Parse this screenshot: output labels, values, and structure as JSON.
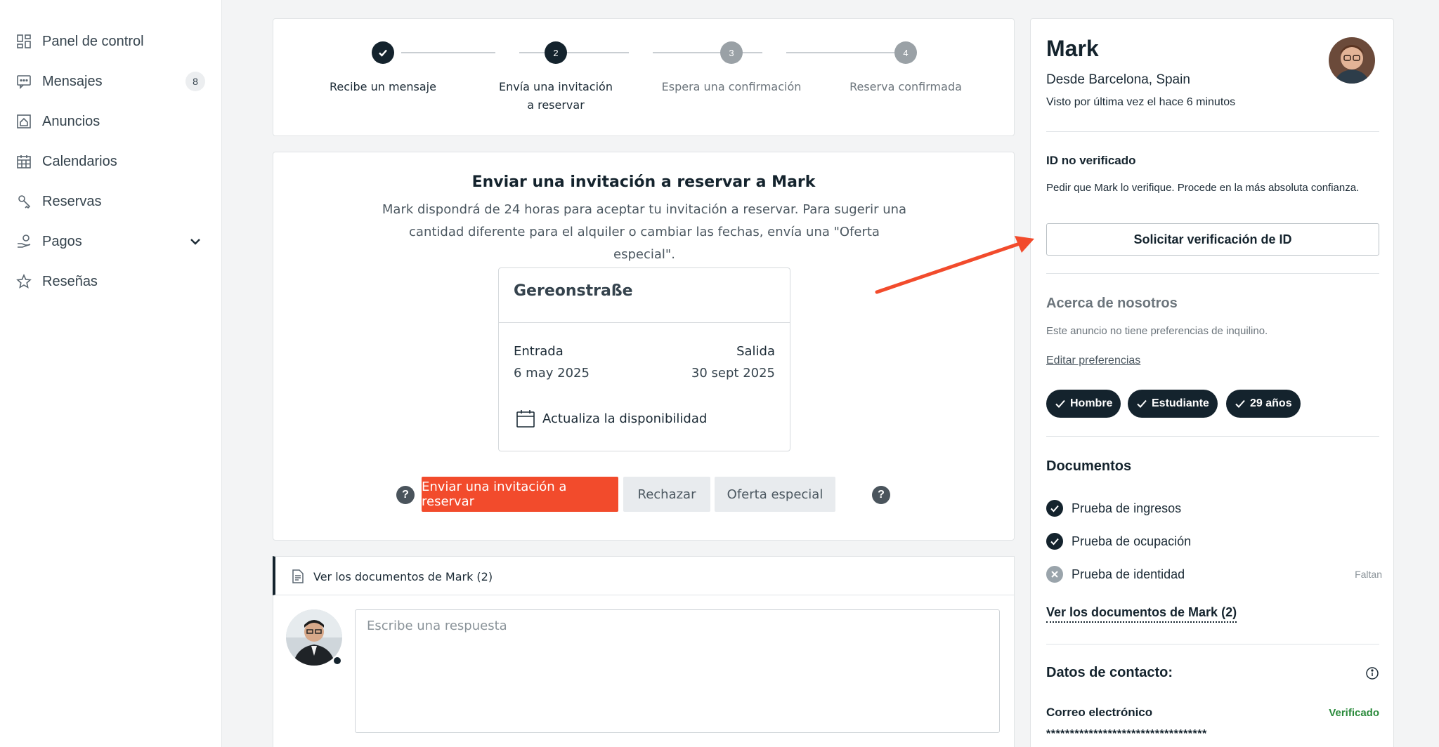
{
  "sidebar": {
    "items": [
      {
        "label": "Panel de control",
        "icon": "dashboard-icon"
      },
      {
        "label": "Mensajes",
        "icon": "message-icon",
        "badge": "8"
      },
      {
        "label": "Anuncios",
        "icon": "listing-icon"
      },
      {
        "label": "Calendarios",
        "icon": "calendar-icon"
      },
      {
        "label": "Reservas",
        "icon": "booking-icon"
      },
      {
        "label": "Pagos",
        "icon": "payment-icon"
      },
      {
        "label": "Reseñas",
        "icon": "star-icon"
      }
    ]
  },
  "stepper": {
    "steps": [
      {
        "number": "1",
        "label": "Recibe un mensaje",
        "state": "done"
      },
      {
        "number": "2",
        "label": "Envía una invitación a reservar",
        "state": "active"
      },
      {
        "number": "3",
        "label": "Espera una confirmación",
        "state": "pending"
      },
      {
        "number": "4",
        "label": "Reserva confirmada",
        "state": "pending"
      }
    ]
  },
  "invitation": {
    "title": "Enviar una invitación a reservar a Mark",
    "description": "Mark dispondrá de 24 horas para aceptar tu invitación a reservar. Para sugerir una cantidad diferente para el alquiler o cambiar las fechas, envía una \"Oferta especial\".",
    "listing": {
      "name": "Gereonstraße",
      "checkin_label": "Entrada",
      "checkin_value": "6 may 2025",
      "checkout_label": "Salida",
      "checkout_value": "30 sept 2025",
      "availability_label": "Actualiza la disponibilidad"
    },
    "actions": {
      "help_symbol": "?",
      "send_label": "Enviar una invitación a reservar",
      "reject_label": "Rechazar",
      "special_offer_label": "Oferta especial"
    }
  },
  "documents_bar": {
    "label": "Ver los documentos de Mark (2)"
  },
  "reply": {
    "placeholder": "Escribe una respuesta"
  },
  "profile": {
    "name": "Mark",
    "from": "Desde Barcelona, Spain",
    "last_seen": "Visto por última vez el hace 6 minutos",
    "id_status_title": "ID no verificado",
    "id_status_text": "Pedir que Mark lo verifique. Procede en la más absoluta confianza.",
    "verify_button": "Solicitar verificación de ID",
    "about_title": "Acerca de nosotros",
    "about_text": "Este anuncio no tiene preferencias de inquilino.",
    "edit_preferences": "Editar preferencias",
    "chips": [
      "Hombre",
      "Estudiante",
      "29 años"
    ],
    "documents_title": "Documentos",
    "documents": [
      {
        "label": "Prueba de ingresos",
        "status": "ok",
        "note": ""
      },
      {
        "label": "Prueba de ocupación",
        "status": "ok",
        "note": ""
      },
      {
        "label": "Prueba de identidad",
        "status": "missing",
        "note": "Faltan"
      }
    ],
    "documents_link": "Ver los documentos de Mark (2)",
    "contact_title": "Datos de contacto:",
    "email_label": "Correo electrónico",
    "email_status": "Verificado",
    "email_value": "**********************************"
  },
  "colors": {
    "accent": "#f24b2c",
    "dark": "#14232d",
    "verified": "#2a8a3b"
  }
}
